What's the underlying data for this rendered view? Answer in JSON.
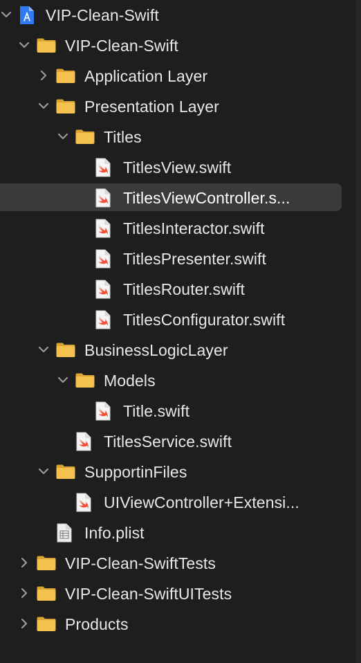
{
  "navigator": {
    "items": [
      {
        "label": "VIP-Clean-Swift",
        "type": "project",
        "depth": 0,
        "disclosure": "expanded",
        "selected": false
      },
      {
        "label": "VIP-Clean-Swift",
        "type": "folder",
        "depth": 1,
        "disclosure": "expanded",
        "selected": false
      },
      {
        "label": "Application Layer",
        "type": "folder",
        "depth": 2,
        "disclosure": "collapsed",
        "selected": false
      },
      {
        "label": "Presentation Layer",
        "type": "folder",
        "depth": 2,
        "disclosure": "expanded",
        "selected": false
      },
      {
        "label": "Titles",
        "type": "folder",
        "depth": 3,
        "disclosure": "expanded",
        "selected": false
      },
      {
        "label": "TitlesView.swift",
        "type": "swift",
        "depth": 4,
        "disclosure": "none",
        "selected": false
      },
      {
        "label": "TitlesViewController.s...",
        "type": "swift",
        "depth": 4,
        "disclosure": "none",
        "selected": true
      },
      {
        "label": "TitlesInteractor.swift",
        "type": "swift",
        "depth": 4,
        "disclosure": "none",
        "selected": false
      },
      {
        "label": "TitlesPresenter.swift",
        "type": "swift",
        "depth": 4,
        "disclosure": "none",
        "selected": false
      },
      {
        "label": "TitlesRouter.swift",
        "type": "swift",
        "depth": 4,
        "disclosure": "none",
        "selected": false
      },
      {
        "label": "TitlesConfigurator.swift",
        "type": "swift",
        "depth": 4,
        "disclosure": "none",
        "selected": false
      },
      {
        "label": "BusinessLogicLayer",
        "type": "folder",
        "depth": 2,
        "disclosure": "expanded",
        "selected": false
      },
      {
        "label": "Models",
        "type": "folder",
        "depth": 3,
        "disclosure": "expanded",
        "selected": false
      },
      {
        "label": "Title.swift",
        "type": "swift",
        "depth": 4,
        "disclosure": "none",
        "selected": false
      },
      {
        "label": "TitlesService.swift",
        "type": "swift",
        "depth": 3,
        "disclosure": "none",
        "selected": false
      },
      {
        "label": "SupportinFiles",
        "type": "folder",
        "depth": 2,
        "disclosure": "expanded",
        "selected": false
      },
      {
        "label": "UIViewController+Extensi...",
        "type": "swift",
        "depth": 3,
        "disclosure": "none",
        "selected": false
      },
      {
        "label": "Info.plist",
        "type": "plist",
        "depth": 2,
        "disclosure": "none",
        "selected": false
      },
      {
        "label": "VIP-Clean-SwiftTests",
        "type": "folder",
        "depth": 1,
        "disclosure": "collapsed",
        "selected": false
      },
      {
        "label": "VIP-Clean-SwiftUITests",
        "type": "folder",
        "depth": 1,
        "disclosure": "collapsed",
        "selected": false
      },
      {
        "label": "Products",
        "type": "folder",
        "depth": 1,
        "disclosure": "collapsed",
        "selected": false
      }
    ]
  },
  "icons": {
    "project": "xcode-project-icon",
    "folder": "folder-icon",
    "swift": "swift-file-icon",
    "plist": "plist-file-icon"
  },
  "colors": {
    "background": "#1e1e1e",
    "selection": "#3a3a3c",
    "text": "#e8e8e8",
    "folder": "#f4c04e",
    "swift_accent": "#f05138",
    "project_blue": "#2f7bf5"
  }
}
